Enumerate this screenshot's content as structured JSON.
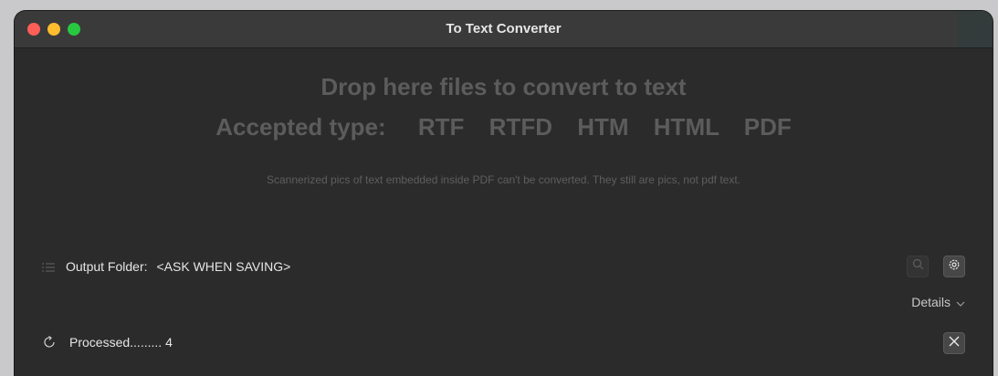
{
  "window": {
    "title": "To Text Converter"
  },
  "drop_zone": {
    "heading": "Drop here files to convert to text",
    "accepted_label": "Accepted type:",
    "accepted_types": [
      "RTF",
      "RTFD",
      "HTM",
      "HTML",
      "PDF"
    ],
    "note": "Scannerized pics of text embedded inside PDF can't be converted. They still are pics, not pdf text."
  },
  "output": {
    "label": "Output Folder:",
    "value": "<ASK WHEN SAVING>"
  },
  "details": {
    "label": "Details"
  },
  "status": {
    "processed_label": "Processed.........",
    "processed_count": "4"
  },
  "icons": {
    "list": "list-icon",
    "search": "search-icon",
    "gear": "gear-icon",
    "chevron": "chevron-down-icon",
    "refresh": "refresh-icon",
    "close": "close-icon"
  },
  "colors": {
    "background": "#2b2b2b",
    "titlebar": "#3a3a3a",
    "muted_text": "#5c5c5c",
    "text": "#e6e6e6"
  }
}
